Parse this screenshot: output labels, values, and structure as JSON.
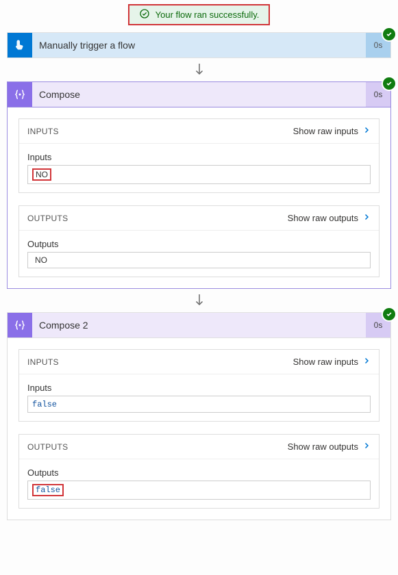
{
  "banner": {
    "text": "Your flow ran successfully."
  },
  "trigger": {
    "title": "Manually trigger a flow",
    "duration": "0s"
  },
  "labels": {
    "inputs_header": "INPUTS",
    "outputs_header": "OUTPUTS",
    "show_raw_inputs": "Show raw inputs",
    "show_raw_outputs": "Show raw outputs",
    "inputs_field": "Inputs",
    "outputs_field": "Outputs"
  },
  "compose1": {
    "title": "Compose",
    "duration": "0s",
    "inputs_value": "NO",
    "outputs_value": "NO"
  },
  "compose2": {
    "title": "Compose 2",
    "duration": "0s",
    "inputs_value": "false",
    "outputs_value": "false"
  }
}
